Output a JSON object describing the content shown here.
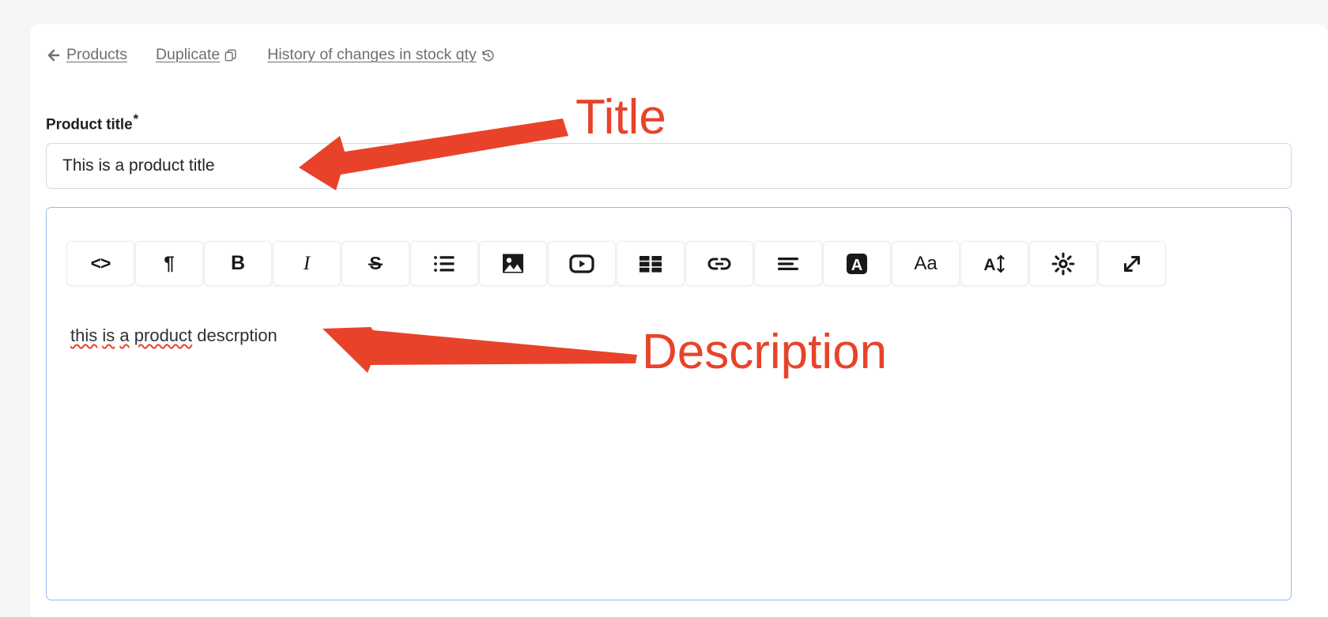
{
  "page": {
    "background_color": "#f4f6f8",
    "card_color": "#ffffff"
  },
  "actionbar": {
    "links": [
      {
        "label": "Products",
        "icon": "back-arrow-icon"
      },
      {
        "label": "Duplicate",
        "icon": "copy-icon"
      },
      {
        "label": "History of changes in stock qty",
        "icon": "history-clock-icon"
      }
    ]
  },
  "form": {
    "title_field": {
      "label": "Product title",
      "required_marker": "*",
      "value": "This is a product title",
      "placeholder": ""
    },
    "description_field": {
      "text_plain": "this is a product descrption",
      "words": [
        {
          "text": "this",
          "misspelled": true
        },
        {
          "text": "is",
          "misspelled": true
        },
        {
          "text": "a",
          "misspelled": true
        },
        {
          "text": "product",
          "misspelled": true
        },
        {
          "text": "descrption",
          "misspelled": false
        }
      ],
      "border_color": "#92bdeb"
    }
  },
  "toolbar": {
    "buttons": [
      {
        "name": "source-code-button",
        "icon": "code-brackets-icon",
        "glyph": "<>",
        "kind": "text"
      },
      {
        "name": "paragraph-button",
        "icon": "pilcrow-icon",
        "glyph": "¶",
        "kind": "text"
      },
      {
        "name": "bold-button",
        "icon": "bold-icon",
        "glyph": "B",
        "kind": "text"
      },
      {
        "name": "italic-button",
        "icon": "italic-icon",
        "glyph": "I",
        "kind": "text"
      },
      {
        "name": "strikethrough-button",
        "icon": "strikethrough-icon",
        "glyph": "S",
        "kind": "svg"
      },
      {
        "name": "bullet-list-button",
        "icon": "bullet-list-icon",
        "glyph": "",
        "kind": "svg"
      },
      {
        "name": "insert-image-button",
        "icon": "image-icon",
        "glyph": "",
        "kind": "svg"
      },
      {
        "name": "insert-video-button",
        "icon": "video-play-icon",
        "glyph": "",
        "kind": "svg"
      },
      {
        "name": "insert-table-button",
        "icon": "table-grid-icon",
        "glyph": "",
        "kind": "svg"
      },
      {
        "name": "insert-link-button",
        "icon": "link-chain-icon",
        "glyph": "",
        "kind": "svg"
      },
      {
        "name": "text-align-button",
        "icon": "align-lines-icon",
        "glyph": "",
        "kind": "svg"
      },
      {
        "name": "text-color-button",
        "icon": "letter-a-filled-icon",
        "glyph": "A",
        "kind": "svg"
      },
      {
        "name": "font-size-button",
        "icon": "font-size-aa-icon",
        "glyph": "Aa",
        "kind": "text"
      },
      {
        "name": "line-height-button",
        "icon": "line-height-icon",
        "glyph": "A",
        "kind": "svg"
      },
      {
        "name": "brightness-button",
        "icon": "sun-brightness-icon",
        "glyph": "",
        "kind": "svg"
      },
      {
        "name": "fullscreen-button",
        "icon": "expand-diagonal-icon",
        "glyph": "",
        "kind": "svg"
      }
    ]
  },
  "annotations": {
    "color": "#e8432a",
    "items": [
      {
        "label": "Title",
        "points_to": "title-input"
      },
      {
        "label": "Description",
        "points_to": "editor-body"
      }
    ]
  }
}
